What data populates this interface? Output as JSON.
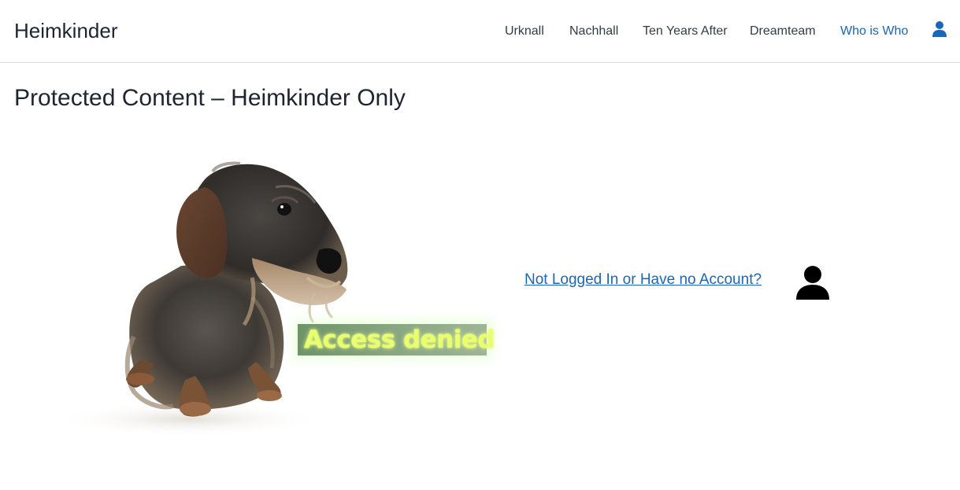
{
  "header": {
    "site_title": "Heimkinder",
    "nav": [
      {
        "label": "Urknall",
        "active": false
      },
      {
        "label": "Nachhall",
        "active": false
      },
      {
        "label": "Ten Years After",
        "active": false
      },
      {
        "label": "Dreamteam",
        "active": false
      },
      {
        "label": "Who is Who",
        "active": true
      }
    ],
    "user_icon": "user-icon"
  },
  "main": {
    "title": "Protected Content – Heimkinder Only",
    "image": {
      "subject": "dog-illustration",
      "badge_text": "Access denied"
    },
    "login_link": "Not Logged In or Have no Account?",
    "login_icon": "person-icon"
  },
  "colors": {
    "link": "#1a66b8",
    "text": "#1e2530",
    "badge_text": "#e9ff6e",
    "badge_bg": "#86a47f"
  }
}
